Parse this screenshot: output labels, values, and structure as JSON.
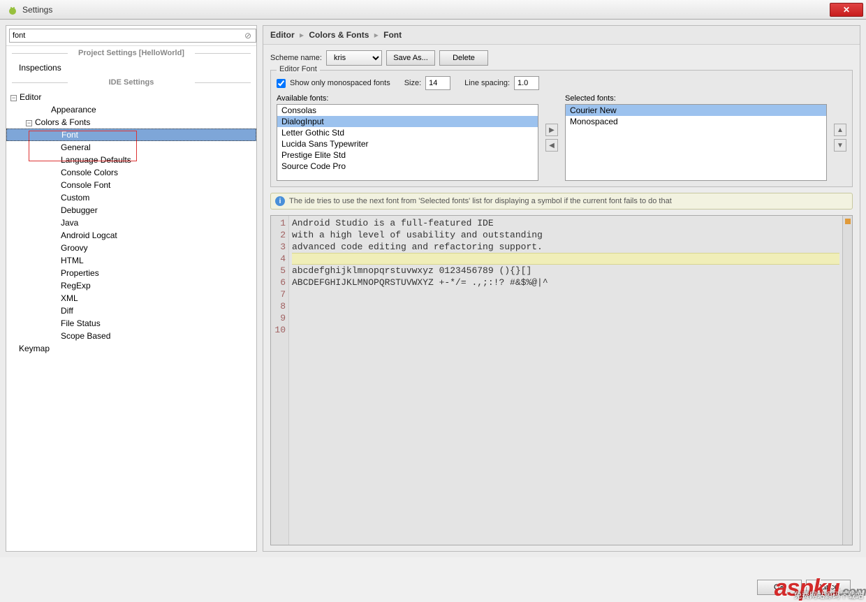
{
  "window": {
    "title": "Settings"
  },
  "search": {
    "value": "font"
  },
  "section_project": "Project Settings [HelloWorld]",
  "section_ide": "IDE Settings",
  "tree": {
    "inspections": "Inspections",
    "editor": "Editor",
    "appearance": "Appearance",
    "colors_fonts": "Colors & Fonts",
    "font": "Font",
    "general": "General",
    "language_defaults": "Language Defaults",
    "console_colors": "Console Colors",
    "console_font": "Console Font",
    "custom": "Custom",
    "debugger": "Debugger",
    "java": "Java",
    "android_logcat": "Android Logcat",
    "groovy": "Groovy",
    "html": "HTML",
    "properties": "Properties",
    "regexp": "RegExp",
    "xml": "XML",
    "diff": "Diff",
    "file_status": "File Status",
    "scope_based": "Scope Based",
    "keymap": "Keymap"
  },
  "breadcrumb": {
    "p1": "Editor",
    "p2": "Colors & Fonts",
    "p3": "Font"
  },
  "scheme": {
    "label": "Scheme name:",
    "value": "kris",
    "save_as": "Save As...",
    "delete": "Delete"
  },
  "editor_font": {
    "group": "Editor Font",
    "show_mono": "Show only monospaced fonts",
    "size_label": "Size:",
    "size_value": "14",
    "spacing_label": "Line spacing:",
    "spacing_value": "1.0",
    "available_label": "Available fonts:",
    "selected_label": "Selected fonts:",
    "available": [
      "Consolas",
      "DialogInput",
      "Letter Gothic Std",
      "Lucida Sans Typewriter",
      "Prestige Elite Std",
      "Source Code Pro"
    ],
    "available_selected": "DialogInput",
    "selected": [
      "Courier New",
      "Monospaced"
    ],
    "selected_selected": "Courier New"
  },
  "info": "The ide tries to use the next font from 'Selected fonts' list for displaying a symbol if the current font fails to do that",
  "preview": {
    "lines": [
      "Android Studio is a full-featured IDE",
      "with a high level of usability and outstanding",
      "advanced code editing and refactoring support.",
      "",
      "abcdefghijklmnopqrstuvwxyz 0123456789 (){}[]",
      "ABCDEFGHIJKLMNOPQRSTUVWXYZ +-*/= .,;:!? #&$%@|^",
      "",
      "",
      "",
      ""
    ]
  },
  "buttons": {
    "ok": "OK",
    "cancel": "Cancel"
  },
  "watermark": {
    "brand": "aspku",
    "suffix": ".com",
    "sub": "免费网站源码下载站"
  }
}
